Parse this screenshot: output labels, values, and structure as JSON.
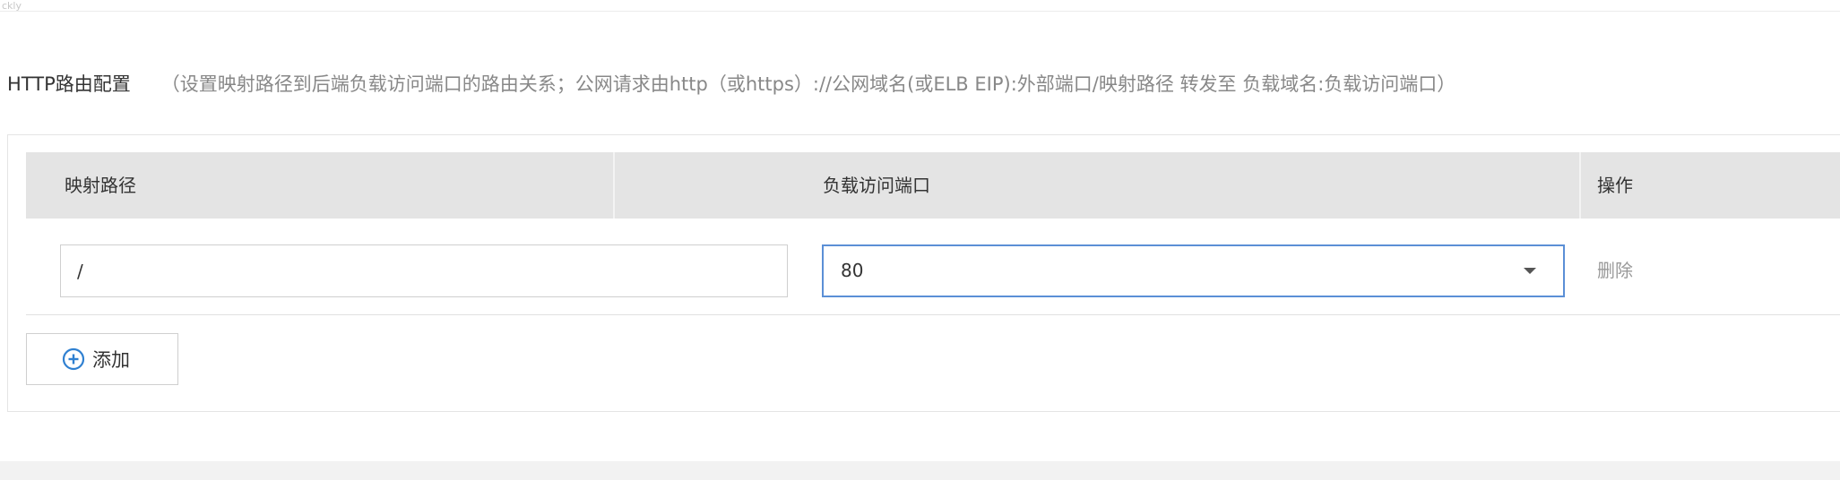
{
  "corner_label": "ckly",
  "routing": {
    "title": "HTTP路由配置",
    "description": "（设置映射路径到后端负载访问端口的路由关系；公网请求由http（或https）://公网域名(或ELB EIP):外部端口/映射路径 转发至 负载域名:负载访问端口）"
  },
  "table": {
    "columns": [
      "映射路径",
      "负载访问端口",
      "操作"
    ],
    "rows": [
      {
        "path": "/",
        "port": "80",
        "action": "删除"
      }
    ]
  },
  "add_button": {
    "label": "添加",
    "icon": "plus-circle-icon"
  },
  "colors": {
    "header_bg": "#e4e4e4",
    "accent": "#5b8fd6",
    "icon_blue": "#2f80d1"
  }
}
